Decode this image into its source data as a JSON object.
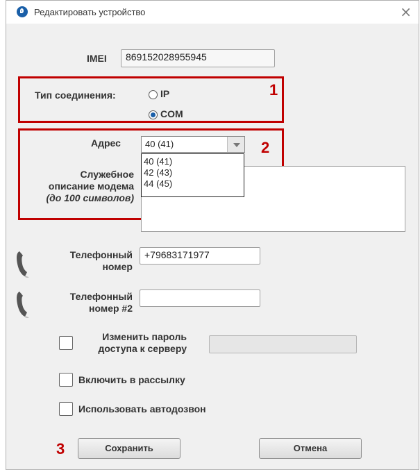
{
  "window": {
    "title": "Редактировать устройство",
    "close_glyph": "×"
  },
  "imei": {
    "label": "IMEI",
    "value": "869152028955945"
  },
  "connection": {
    "label": "Тип соединения:",
    "options": [
      {
        "label": "IP",
        "selected": false
      },
      {
        "label": "COM",
        "selected": true
      }
    ]
  },
  "address": {
    "label": "Адрес",
    "selected": "40 (41)",
    "options": [
      "40 (41)",
      "42 (43)",
      "44 (45)"
    ]
  },
  "description": {
    "label_line1": "Служебное",
    "label_line2": "описание модема",
    "label_line3": "(до 100 символов)",
    "value": ""
  },
  "phone1": {
    "label_line1": "Телефонный",
    "label_line2": "номер",
    "value": "+79683171977",
    "icon": "phone-icon"
  },
  "phone2": {
    "label_line1": "Телефонный",
    "label_line2": "номер #2",
    "value": "",
    "icon": "phone-icon"
  },
  "change_password": {
    "label_line1": "Изменить пароль",
    "label_line2": "доступа к серверу",
    "checked": false,
    "value": ""
  },
  "mailing": {
    "label": "Включить в рассылку",
    "checked": false
  },
  "autodial": {
    "label": "Использовать автодозвон",
    "checked": false
  },
  "buttons": {
    "save": "Сохранить",
    "cancel": "Отмена"
  },
  "markers": {
    "m1": "1",
    "m2": "2",
    "m3": "3"
  },
  "colors": {
    "annotation_red": "#c00000",
    "accent_blue": "#1a5fa8"
  }
}
